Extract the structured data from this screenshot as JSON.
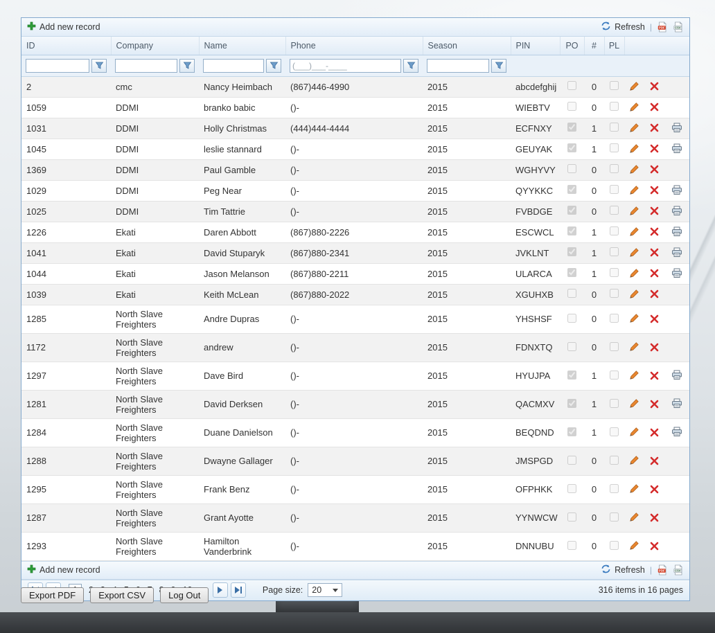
{
  "colors": {
    "panel_border": "#84a9cd",
    "toolbar_bg": "#e9f2fa",
    "alt_row": "#f2f2f2",
    "pencil_orange": "#e8862f",
    "delete_red": "#d42b2b",
    "pager_arrow_blue": "#3a6ea5"
  },
  "icons": {
    "add": "green-plus",
    "refresh": "circular-arrows",
    "pdf_export": "pdf-file",
    "csv_export": "csv-file",
    "filter": "funnel",
    "edit": "pencil",
    "delete": "red-x",
    "print": "printer"
  },
  "toolbar": {
    "add_label": "Add new record",
    "refresh_label": "Refresh",
    "separator": "|"
  },
  "columns": {
    "id": "ID",
    "company": "Company",
    "name": "Name",
    "phone": "Phone",
    "season": "Season",
    "pin": "PIN",
    "po": "PO",
    "count": "#",
    "pl": "PL"
  },
  "filter": {
    "phone_placeholder": "(___)___-____"
  },
  "rows": [
    {
      "id": "2",
      "company": "cmc",
      "name": "Nancy Heimbach",
      "phone": "(867)446-4990",
      "season": "2015",
      "pin": "abcdefghij",
      "po": false,
      "num": "0",
      "pl": false,
      "print": false
    },
    {
      "id": "1059",
      "company": "DDMI",
      "name": "branko babic",
      "phone": "()-",
      "season": "2015",
      "pin": "WIEBTV",
      "po": false,
      "num": "0",
      "pl": false,
      "print": false
    },
    {
      "id": "1031",
      "company": "DDMI",
      "name": "Holly Christmas",
      "phone": "(444)444-4444",
      "season": "2015",
      "pin": "ECFNXY",
      "po": true,
      "num": "1",
      "pl": false,
      "print": true
    },
    {
      "id": "1045",
      "company": "DDMI",
      "name": "leslie stannard",
      "phone": "()-",
      "season": "2015",
      "pin": "GEUYAK",
      "po": true,
      "num": "1",
      "pl": false,
      "print": true
    },
    {
      "id": "1369",
      "company": "DDMI",
      "name": "Paul Gamble",
      "phone": "()-",
      "season": "2015",
      "pin": "WGHYVY",
      "po": false,
      "num": "0",
      "pl": false,
      "print": false
    },
    {
      "id": "1029",
      "company": "DDMI",
      "name": "Peg Near",
      "phone": "()-",
      "season": "2015",
      "pin": "QYYKKC",
      "po": true,
      "num": "0",
      "pl": false,
      "print": true
    },
    {
      "id": "1025",
      "company": "DDMI",
      "name": "Tim Tattrie",
      "phone": "()-",
      "season": "2015",
      "pin": "FVBDGE",
      "po": true,
      "num": "0",
      "pl": false,
      "print": true
    },
    {
      "id": "1226",
      "company": "Ekati",
      "name": "Daren Abbott",
      "phone": "(867)880-2226",
      "season": "2015",
      "pin": "ESCWCL",
      "po": true,
      "num": "1",
      "pl": false,
      "print": true
    },
    {
      "id": "1041",
      "company": "Ekati",
      "name": "David Stuparyk",
      "phone": "(867)880-2341",
      "season": "2015",
      "pin": "JVKLNT",
      "po": true,
      "num": "1",
      "pl": false,
      "print": true
    },
    {
      "id": "1044",
      "company": "Ekati",
      "name": "Jason Melanson",
      "phone": "(867)880-2211",
      "season": "2015",
      "pin": "ULARCA",
      "po": true,
      "num": "1",
      "pl": false,
      "print": true
    },
    {
      "id": "1039",
      "company": "Ekati",
      "name": "Keith McLean",
      "phone": "(867)880-2022",
      "season": "2015",
      "pin": "XGUHXB",
      "po": false,
      "num": "0",
      "pl": false,
      "print": false
    },
    {
      "id": "1285",
      "company": "North Slave Freighters",
      "name": "Andre Dupras",
      "phone": "()-",
      "season": "2015",
      "pin": "YHSHSF",
      "po": false,
      "num": "0",
      "pl": false,
      "print": false
    },
    {
      "id": "1172",
      "company": "North Slave Freighters",
      "name": "andrew",
      "phone": "()-",
      "season": "2015",
      "pin": "FDNXTQ",
      "po": false,
      "num": "0",
      "pl": false,
      "print": false
    },
    {
      "id": "1297",
      "company": "North Slave Freighters",
      "name": "Dave Bird",
      "phone": "()-",
      "season": "2015",
      "pin": "HYUJPA",
      "po": true,
      "num": "1",
      "pl": false,
      "print": true
    },
    {
      "id": "1281",
      "company": "North Slave Freighters",
      "name": "David Derksen",
      "phone": "()-",
      "season": "2015",
      "pin": "QACMXV",
      "po": true,
      "num": "1",
      "pl": false,
      "print": true
    },
    {
      "id": "1284",
      "company": "North Slave Freighters",
      "name": "Duane Danielson",
      "phone": "()-",
      "season": "2015",
      "pin": "BEQDND",
      "po": true,
      "num": "1",
      "pl": false,
      "print": true
    },
    {
      "id": "1288",
      "company": "North Slave Freighters",
      "name": "Dwayne Gallager",
      "phone": "()-",
      "season": "2015",
      "pin": "JMSPGD",
      "po": false,
      "num": "0",
      "pl": false,
      "print": false
    },
    {
      "id": "1295",
      "company": "North Slave Freighters",
      "name": "Frank Benz",
      "phone": "()-",
      "season": "2015",
      "pin": "OFPHKK",
      "po": false,
      "num": "0",
      "pl": false,
      "print": false
    },
    {
      "id": "1287",
      "company": "North Slave Freighters",
      "name": "Grant Ayotte",
      "phone": "()-",
      "season": "2015",
      "pin": "YYNWCW",
      "po": false,
      "num": "0",
      "pl": false,
      "print": false
    },
    {
      "id": "1293",
      "company": "North Slave Freighters",
      "name": "Hamilton Vanderbrink",
      "phone": "()-",
      "season": "2015",
      "pin": "DNNUBU",
      "po": false,
      "num": "0",
      "pl": false,
      "print": false
    }
  ],
  "pager": {
    "pages": [
      "1",
      "2",
      "3",
      "4",
      "5",
      "6",
      "7",
      "8",
      "9",
      "10"
    ],
    "current_page": "1",
    "ellipsis": "...",
    "page_size_label": "Page size:",
    "page_size_value": "20",
    "summary": "316 items in 16 pages"
  },
  "footer_buttons": {
    "export_pdf": "Export PDF",
    "export_csv": "Export CSV",
    "log_out": "Log Out"
  }
}
